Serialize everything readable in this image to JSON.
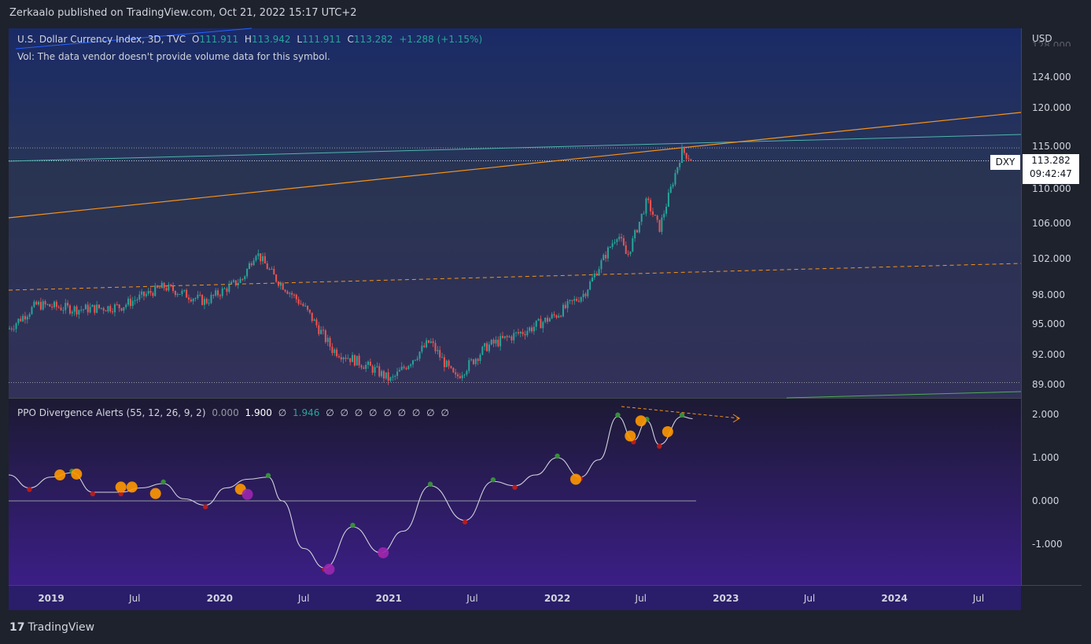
{
  "header": {
    "publisher": "Zerkaalo published on TradingView.com, Oct 21, 2022 15:17 UTC+2"
  },
  "legend": {
    "symbol": "U.S. Dollar Currency Index, 3D, TVC",
    "o_label": "O",
    "o_value": "111.911",
    "h_label": "H",
    "h_value": "113.942",
    "l_label": "L",
    "l_value": "111.911",
    "c_label": "C",
    "c_value": "113.282",
    "change": "+1.288 (+1.15%)",
    "vol": "Vol: The data vendor doesn't provide volume data for this symbol."
  },
  "price_scale": {
    "currency": "USD",
    "ticks": [
      "124.000",
      "120.000",
      "115.000",
      "110.000",
      "106.000",
      "102.000",
      "98.000",
      "95.000",
      "92.000",
      "89.000"
    ],
    "tick_values": [
      124,
      120,
      115,
      110,
      106,
      102,
      98,
      95,
      92,
      89
    ],
    "symbol_tag": "DXY",
    "last_price": "113.282",
    "countdown": "09:42:47"
  },
  "ppo": {
    "title": "PPO Divergence Alerts (55, 12, 26, 9, 2)",
    "v1": "0.000",
    "v2": "1.900",
    "v3": "1.946",
    "null_symbol": "∅",
    "ticks": [
      "2.000",
      "1.000",
      "0.000",
      "-1.000"
    ],
    "tick_values": [
      2,
      1,
      0,
      -1
    ]
  },
  "time_axis": {
    "labels": [
      "2019",
      "Jul",
      "2020",
      "Jul",
      "2021",
      "Jul",
      "2022",
      "Jul",
      "2023",
      "Jul",
      "2024",
      "Jul"
    ]
  },
  "footer": {
    "logo_glyph": "17",
    "brand": "TradingView"
  },
  "colors": {
    "up": "#26a69a",
    "down": "#ef5350",
    "trend": "#f7931a",
    "channel": "#4caf50",
    "ppo_line": "#d1d4dc",
    "dot_green": "#388e3c",
    "dot_red": "#b71c1c",
    "dot_orange": "#ff9800",
    "dot_purple": "#9c27b0"
  },
  "chart_data": {
    "type": "candlestick",
    "series_name": "DXY",
    "x_range": [
      "2018-10",
      "2024-10"
    ],
    "y_range": [
      88,
      128
    ],
    "close_path": [
      [
        "2018-10-01",
        94.5
      ],
      [
        "2018-12-01",
        97.0
      ],
      [
        "2019-03-01",
        96.5
      ],
      [
        "2019-06-01",
        96.8
      ],
      [
        "2019-09-01",
        98.9
      ],
      [
        "2019-12-01",
        97.3
      ],
      [
        "2020-02-20",
        99.8
      ],
      [
        "2020-03-19",
        102.8
      ],
      [
        "2020-05-01",
        99.8
      ],
      [
        "2020-07-01",
        96.8
      ],
      [
        "2020-09-01",
        92.5
      ],
      [
        "2020-12-01",
        90.5
      ],
      [
        "2021-01-06",
        89.4
      ],
      [
        "2021-03-31",
        93.3
      ],
      [
        "2021-05-25",
        89.6
      ],
      [
        "2021-08-01",
        92.8
      ],
      [
        "2021-11-01",
        94.5
      ],
      [
        "2022-01-01",
        96.0
      ],
      [
        "2022-03-01",
        98.2
      ],
      [
        "2022-05-12",
        104.9
      ],
      [
        "2022-06-01",
        102.2
      ],
      [
        "2022-07-14",
        108.6
      ],
      [
        "2022-08-10",
        105.4
      ],
      [
        "2022-09-28",
        114.5
      ],
      [
        "2022-10-21",
        113.282
      ]
    ],
    "lines": [
      {
        "name": "trendline",
        "from": [
          "2018-10-01",
          107.8
        ],
        "to": [
          "2024-10-01",
          120.3
        ]
      },
      {
        "name": "dashed-trendline",
        "from": [
          "2018-10-01",
          97.7
        ],
        "to": [
          "2024-10-01",
          101.8
        ]
      },
      {
        "name": "channel-upper",
        "from": [
          "2018-10-01",
          113.3
        ],
        "to": [
          "2024-10-01",
          116.3
        ]
      },
      {
        "name": "horizontal-high",
        "from": [
          "2018-10-01",
          114.8
        ],
        "to": [
          "2024-10-01",
          114.8
        ]
      },
      {
        "name": "horizontal-low",
        "from": [
          "2018-10-01",
          89.2
        ],
        "to": [
          "2024-10-01",
          89.2
        ]
      }
    ],
    "ppo_values": [
      [
        "2018-10-01",
        0.6
      ],
      [
        "2018-11-15",
        0.3
      ],
      [
        "2019-01-01",
        0.55
      ],
      [
        "2019-02-15",
        0.65
      ],
      [
        "2019-04-01",
        0.2
      ],
      [
        "2019-06-01",
        0.2
      ],
      [
        "2019-07-15",
        0.3
      ],
      [
        "2019-09-01",
        0.4
      ],
      [
        "2019-10-15",
        0.05
      ],
      [
        "2019-12-01",
        -0.1
      ],
      [
        "2020-01-15",
        0.3
      ],
      [
        "2020-03-01",
        0.5
      ],
      [
        "2020-04-15",
        0.55
      ],
      [
        "2020-05-15",
        0.0
      ],
      [
        "2020-07-01",
        -1.1
      ],
      [
        "2020-08-15",
        -1.55
      ],
      [
        "2020-10-15",
        -0.6
      ],
      [
        "2020-12-15",
        -1.2
      ],
      [
        "2021-02-01",
        -0.7
      ],
      [
        "2021-04-01",
        0.35
      ],
      [
        "2021-06-15",
        -0.45
      ],
      [
        "2021-08-15",
        0.45
      ],
      [
        "2021-10-01",
        0.35
      ],
      [
        "2021-11-15",
        0.6
      ],
      [
        "2022-01-01",
        1.0
      ],
      [
        "2022-02-20",
        0.55
      ],
      [
        "2022-04-01",
        0.95
      ],
      [
        "2022-05-12",
        1.95
      ],
      [
        "2022-06-15",
        1.4
      ],
      [
        "2022-07-14",
        1.85
      ],
      [
        "2022-08-10",
        1.3
      ],
      [
        "2022-09-28",
        1.95
      ],
      [
        "2022-10-21",
        1.9
      ]
    ]
  }
}
